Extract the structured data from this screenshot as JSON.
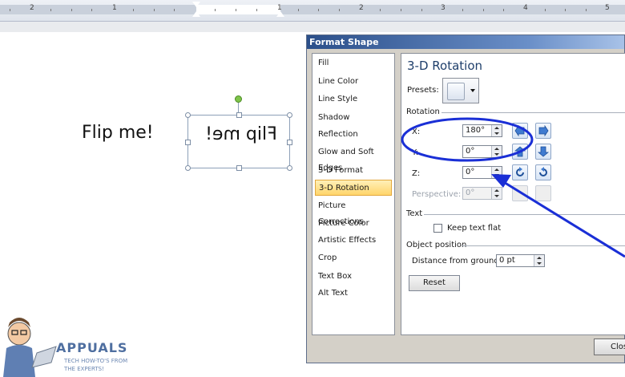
{
  "ruler": {
    "numbers": [
      "2",
      "1",
      "1",
      "2",
      "3",
      "4",
      "5"
    ]
  },
  "document": {
    "plain_text": "Flip me!",
    "shape_text": "Flip me!"
  },
  "dialog": {
    "title": "Format Shape",
    "nav": [
      "Fill",
      "Line Color",
      "Line Style",
      "Shadow",
      "Reflection",
      "Glow and Soft Edges",
      "3-D Format",
      "3-D Rotation",
      "Picture Corrections",
      "Picture Color",
      "Artistic Effects",
      "Crop",
      "Text Box",
      "Alt Text"
    ],
    "selected_nav": "3-D Rotation",
    "panel": {
      "title": "3-D Rotation",
      "presets_label": "Presets:",
      "rotation_section": "Rotation",
      "x_label": "X:",
      "x_value": "180°",
      "y_label": "Y:",
      "y_value": "0°",
      "z_label": "Z:",
      "z_value": "0°",
      "perspective_label": "Perspective:",
      "perspective_value": "0°",
      "text_section": "Text",
      "keep_flat_label": "Keep text flat",
      "position_section": "Object position",
      "distance_label": "Distance from ground:",
      "distance_value": "0 pt",
      "reset_label": "Reset"
    },
    "close_label": "Clos"
  },
  "logo": {
    "name": "APPUALS",
    "tagline_1": "TECH HOW-TO'S FROM",
    "tagline_2": "THE EXPERTS!"
  },
  "annotation_color": "#1a2fd6"
}
